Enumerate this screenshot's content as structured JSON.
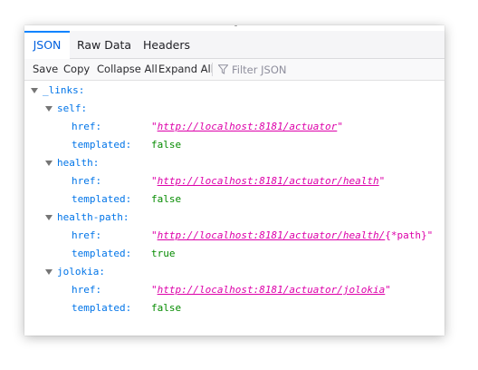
{
  "tabs": [
    "JSON",
    "Raw Data",
    "Headers"
  ],
  "toolbar": {
    "save": "Save",
    "copy": "Copy",
    "collapse_all": "Collapse All",
    "expand_all": "Expand All",
    "filter_placeholder": "Filter JSON"
  },
  "json": {
    "root_key": "_links:",
    "groups": [
      {
        "key": "self:",
        "href_key": "href:",
        "href_link": "http://localhost:8181/actuator",
        "href_suffix": "",
        "templated_key": "templated:",
        "templated": "false"
      },
      {
        "key": "health:",
        "href_key": "href:",
        "href_link": "http://localhost:8181/actuator/health",
        "href_suffix": "",
        "templated_key": "templated:",
        "templated": "false"
      },
      {
        "key": "health-path:",
        "href_key": "href:",
        "href_link": "http://localhost:8181/actuator/health/",
        "href_suffix": "{*path}",
        "templated_key": "templated:",
        "templated": "true"
      },
      {
        "key": "jolokia:",
        "href_key": "href:",
        "href_link": "http://localhost:8181/actuator/jolokia",
        "href_suffix": "",
        "templated_key": "templated:",
        "templated": "false"
      }
    ]
  },
  "colors": {
    "key": "#0074e8",
    "string": "#dd00a9",
    "boolean": "#058b00",
    "active_tab": "#0060df"
  },
  "icons": [
    "filter-icon",
    "expand-toggle-icon"
  ]
}
